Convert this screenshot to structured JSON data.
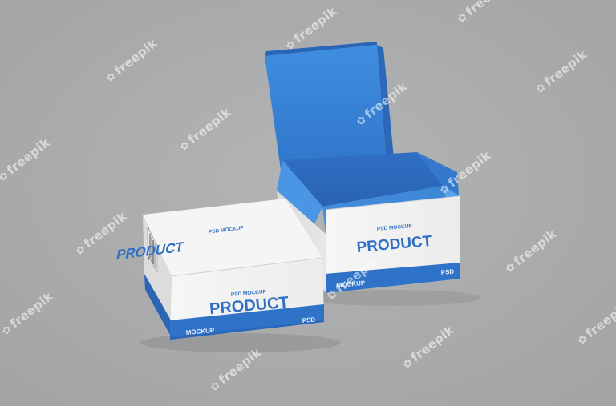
{
  "scene": {
    "background": "#a9aaab",
    "watermark_text": "freepik",
    "watermark_icon": "freepik-logo-icon"
  },
  "colors": {
    "box_blue": "#2f73c9",
    "box_white": "#f4f4f4",
    "inner_blue": "#3c86d8"
  },
  "closed_box": {
    "top_small": "PSD MOCKUP",
    "top_big": "PRODUCT",
    "front_small": "PSD MOCKUP",
    "front_big": "PRODUCT",
    "band_left": "MOCKUP",
    "band_right": "PSD"
  },
  "open_box": {
    "front_small": "PSD MOCKUP",
    "front_big": "PRODUCT",
    "band_left": "MOCKUP",
    "band_right": "PSD"
  }
}
